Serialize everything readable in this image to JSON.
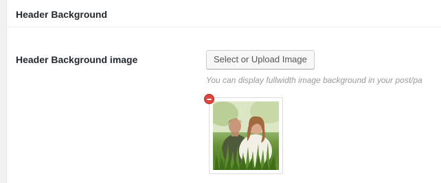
{
  "section": {
    "title": "Header Background"
  },
  "field": {
    "label": "Header Background image",
    "button_label": "Select or Upload Image",
    "help_text": "You can display fullwidth image background in your post/pa"
  },
  "image": {
    "alt": "Header background image: two people sitting in tall grass",
    "remove_icon": "remove-circle-icon"
  },
  "colors": {
    "remove": "#e0443a",
    "help_text": "#999999"
  }
}
